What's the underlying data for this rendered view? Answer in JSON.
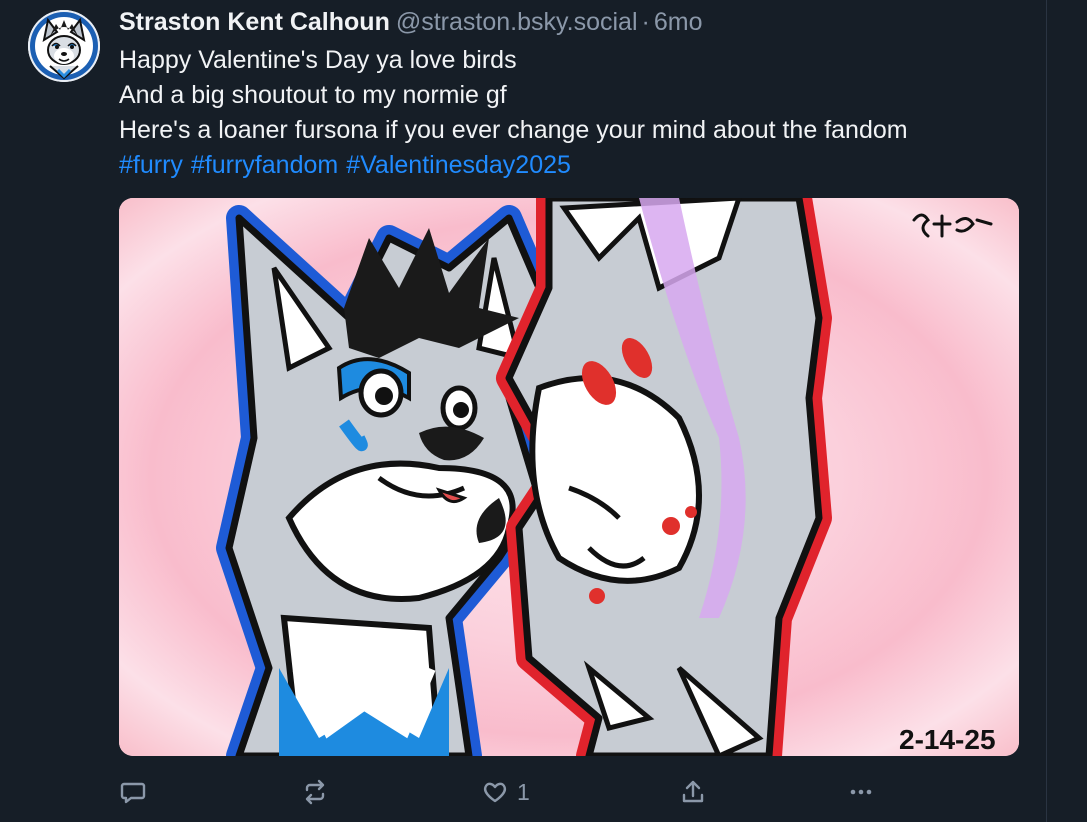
{
  "post": {
    "author": {
      "display_name": "Straston Kent Calhoun",
      "handle": "@straston.bsky.social",
      "separator": "·",
      "time": "6mo",
      "avatar_icon": "furry-wolf-avatar-icon"
    },
    "text_lines": [
      "Happy Valentine's Day ya love birds",
      "And a big shoutout to my normie gf",
      "Here's a loaner fursona if you ever change your mind about the fandom"
    ],
    "hashtags": [
      "#furry",
      "#furryfandom",
      "#Valentinesday2025"
    ],
    "image": {
      "signature_text": "Strxto",
      "date_text": "2-14-25"
    },
    "actions": {
      "reply_icon": "speech-bubble-icon",
      "repost_icon": "repost-arrows-icon",
      "like_icon": "heart-icon",
      "like_count": "1",
      "share_icon": "share-upload-icon",
      "more_icon": "ellipsis-icon"
    }
  },
  "colors": {
    "background": "#161e27",
    "text_primary": "#f1f3f5",
    "text_secondary": "#8b98a9",
    "link": "#208bfe"
  }
}
